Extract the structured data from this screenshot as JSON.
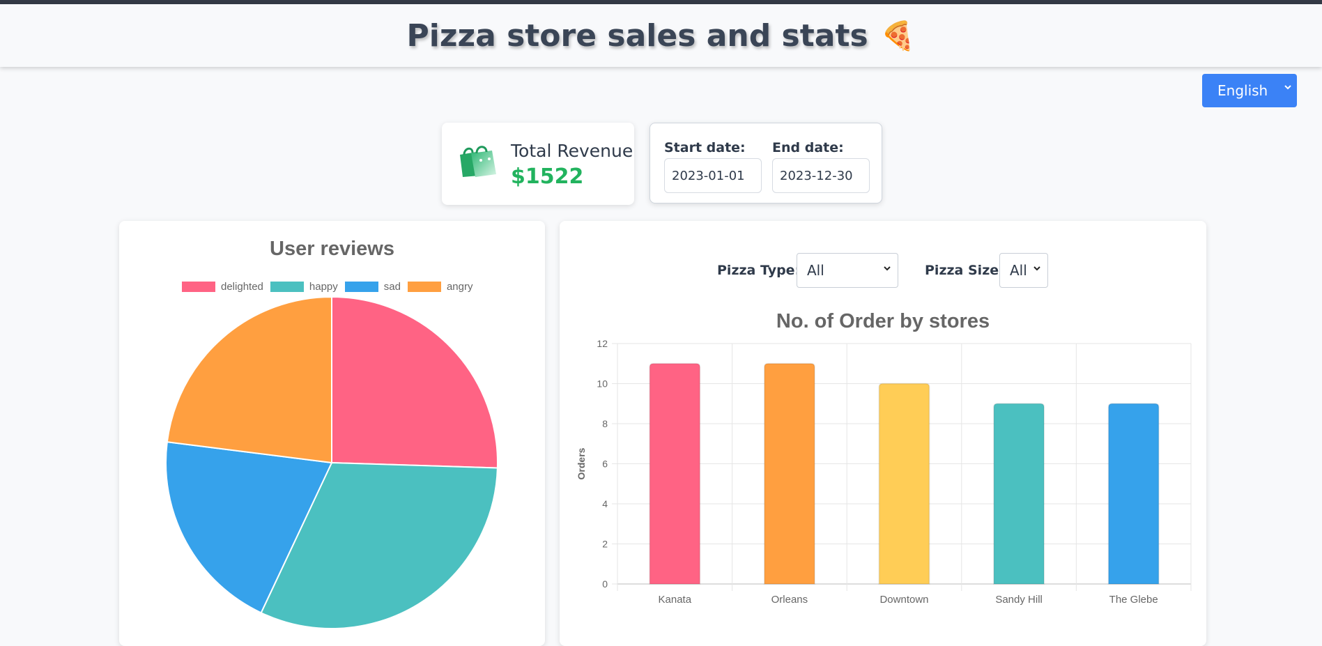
{
  "header": {
    "title": "Pizza store sales and stats",
    "emoji": "🍕"
  },
  "language": {
    "selected": "English"
  },
  "revenue": {
    "label": "Total Revenue",
    "value": "$1522"
  },
  "dates": {
    "start_label": "Start date:",
    "start_value": "2023-01-01",
    "end_label": "End date:",
    "end_value": "2023-12-30"
  },
  "reviews_chart": {
    "title": "User reviews",
    "chart_data": {
      "type": "pie",
      "categories": [
        "delighted",
        "happy",
        "sad",
        "angry"
      ],
      "values": [
        25.5,
        31.5,
        20,
        23
      ],
      "colors": [
        "#ff6384",
        "#4bc0c0",
        "#36a2eb",
        "#ff9f40"
      ],
      "legend_position": "top"
    }
  },
  "filters": {
    "pizza_type_label": "Pizza Type:",
    "pizza_type_value": "All",
    "pizza_size_label": "Pizza Size:",
    "pizza_size_value": "All"
  },
  "orders_chart": {
    "title": "No. of Order by stores",
    "chart_data": {
      "type": "bar",
      "categories": [
        "Kanata",
        "Orleans",
        "Downtown",
        "Sandy Hill",
        "The Glebe"
      ],
      "values": [
        11,
        11,
        10,
        9,
        9
      ],
      "colors": [
        "#ff6384",
        "#ff9f40",
        "#ffcd56",
        "#4bc0c0",
        "#36a2eb"
      ],
      "ylabel": "Orders",
      "ylim": [
        0,
        12
      ],
      "yticks": [
        0,
        2,
        4,
        6,
        8,
        10,
        12
      ],
      "grid": true
    }
  }
}
